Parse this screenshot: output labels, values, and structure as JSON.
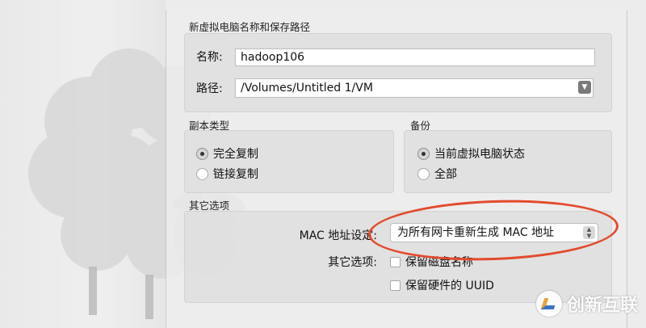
{
  "name_section": {
    "title": "新虚拟电脑名称和保存路径",
    "name_label": "名称:",
    "name_value": "hadoop106",
    "path_label": "路径:",
    "path_value": "/Volumes/Untitled 1/VM"
  },
  "clone_type": {
    "title": "副本类型",
    "options": [
      "完全复制",
      "链接复制"
    ],
    "selected": "完全复制"
  },
  "backup": {
    "title": "备份",
    "options": [
      "当前虚拟电脑状态",
      "全部"
    ],
    "selected": "当前虚拟电脑状态"
  },
  "other": {
    "title": "其它选项",
    "mac_label": "MAC 地址设定:",
    "mac_value": "为所有网卡重新生成 MAC 地址",
    "options_label": "其它选项:",
    "keep_disk_names": "保留磁盘名称",
    "keep_hw_uuid": "保留硬件的 UUID"
  },
  "watermark": {
    "text": "创新互联"
  },
  "colors": {
    "annotation": "#e34a2c",
    "background": "#ececec"
  }
}
